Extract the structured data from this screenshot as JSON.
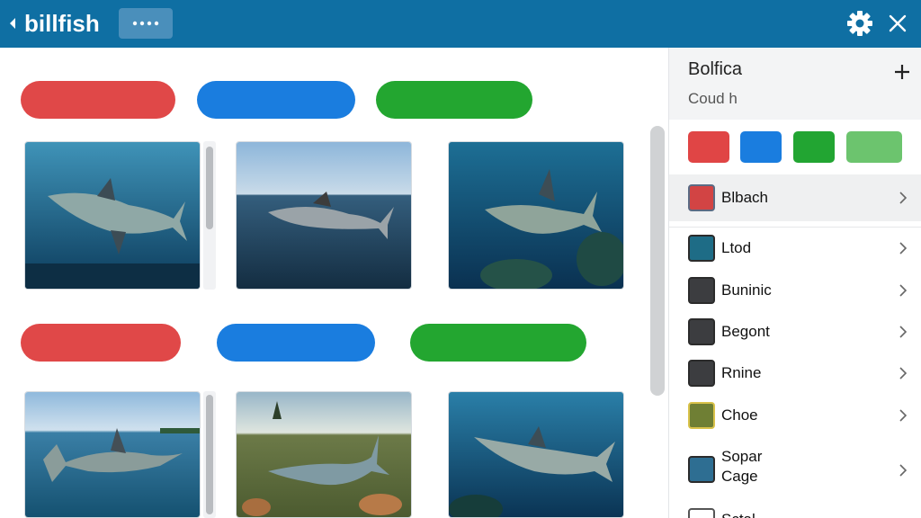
{
  "header": {
    "title": "billfish",
    "back_icon": "chevron-left-icon",
    "more_icon": "more-dots-icon",
    "settings_icon": "gear-icon",
    "close_icon": "close-icon",
    "bg_color": "#0f6fa3"
  },
  "main": {
    "rows": [
      {
        "pills": [
          {
            "color": "#e04848"
          },
          {
            "color": "#1a7ddf"
          },
          {
            "color": "#23a630"
          }
        ],
        "images": [
          "underwater-marlin",
          "marlin-at-sea-surface",
          "marlin-over-reef"
        ]
      },
      {
        "pills": [
          {
            "color": "#e04848"
          },
          {
            "color": "#1a7ddf"
          },
          {
            "color": "#23a630"
          }
        ],
        "images": [
          "marlin-near-coast",
          "marlin-on-grassland",
          "underwater-marlin-rays"
        ]
      }
    ]
  },
  "sidebar": {
    "title": "Bolfica",
    "subtitle": "Coud h",
    "plus_icon": "plus-icon",
    "swatches": [
      "#e04545",
      "#1a7ddf",
      "#22a532",
      "#6cc46e"
    ],
    "items": [
      {
        "label": "Blbach",
        "icon_color": "#d24444",
        "selected": true
      },
      {
        "label": "Ltod",
        "icon_color": "#1e6c86",
        "selected": false
      },
      {
        "label": "Buninic",
        "icon_color": "#3c3d40",
        "selected": false
      },
      {
        "label": "Begont",
        "icon_color": "#3c3d40",
        "selected": false
      },
      {
        "label": "Rnine",
        "icon_color": "#3c3d40",
        "selected": false
      },
      {
        "label": "Choe",
        "icon_color": "#7a8a3a",
        "selected": false
      },
      {
        "label": "Sopar",
        "label2": "Cage",
        "icon_color": "#2e6e92",
        "selected": false
      },
      {
        "label": "Sctal",
        "icon_color": "#ffffff",
        "selected": false
      }
    ]
  }
}
